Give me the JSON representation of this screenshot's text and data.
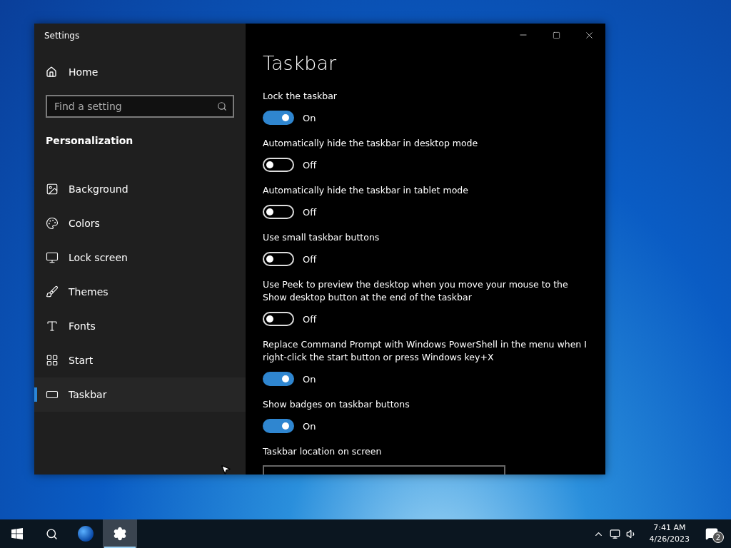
{
  "window": {
    "title": "Settings"
  },
  "sidebar": {
    "home": "Home",
    "search": {
      "placeholder": "Find a setting"
    },
    "section": "Personalization",
    "items": [
      {
        "label": "Background",
        "selected": false
      },
      {
        "label": "Colors",
        "selected": false
      },
      {
        "label": "Lock screen",
        "selected": false
      },
      {
        "label": "Themes",
        "selected": false
      },
      {
        "label": "Fonts",
        "selected": false
      },
      {
        "label": "Start",
        "selected": false
      },
      {
        "label": "Taskbar",
        "selected": true
      }
    ]
  },
  "page": {
    "title": "Taskbar",
    "settings": [
      {
        "kind": "toggle",
        "label": "Lock the taskbar",
        "on": true,
        "state_text": "On"
      },
      {
        "kind": "toggle",
        "label": "Automatically hide the taskbar in desktop mode",
        "on": false,
        "state_text": "Off"
      },
      {
        "kind": "toggle",
        "label": "Automatically hide the taskbar in tablet mode",
        "on": false,
        "state_text": "Off"
      },
      {
        "kind": "toggle",
        "label": "Use small taskbar buttons",
        "on": false,
        "state_text": "Off"
      },
      {
        "kind": "toggle",
        "label": "Use Peek to preview the desktop when you move your mouse to the Show desktop button at the end of the taskbar",
        "on": false,
        "state_text": "Off"
      },
      {
        "kind": "toggle",
        "label": "Replace Command Prompt with Windows PowerShell in the menu when I right-click the start button or press Windows key+X",
        "on": true,
        "state_text": "On"
      },
      {
        "kind": "toggle",
        "label": "Show badges on taskbar buttons",
        "on": true,
        "state_text": "On"
      },
      {
        "kind": "dropdown",
        "label": "Taskbar location on screen"
      }
    ]
  },
  "taskbar": {
    "apps": [
      {
        "kind": "globe",
        "selected": false
      },
      {
        "kind": "settings",
        "selected": true
      }
    ],
    "time": "7:41 AM",
    "date": "4/26/2023",
    "notification_count": "2"
  }
}
